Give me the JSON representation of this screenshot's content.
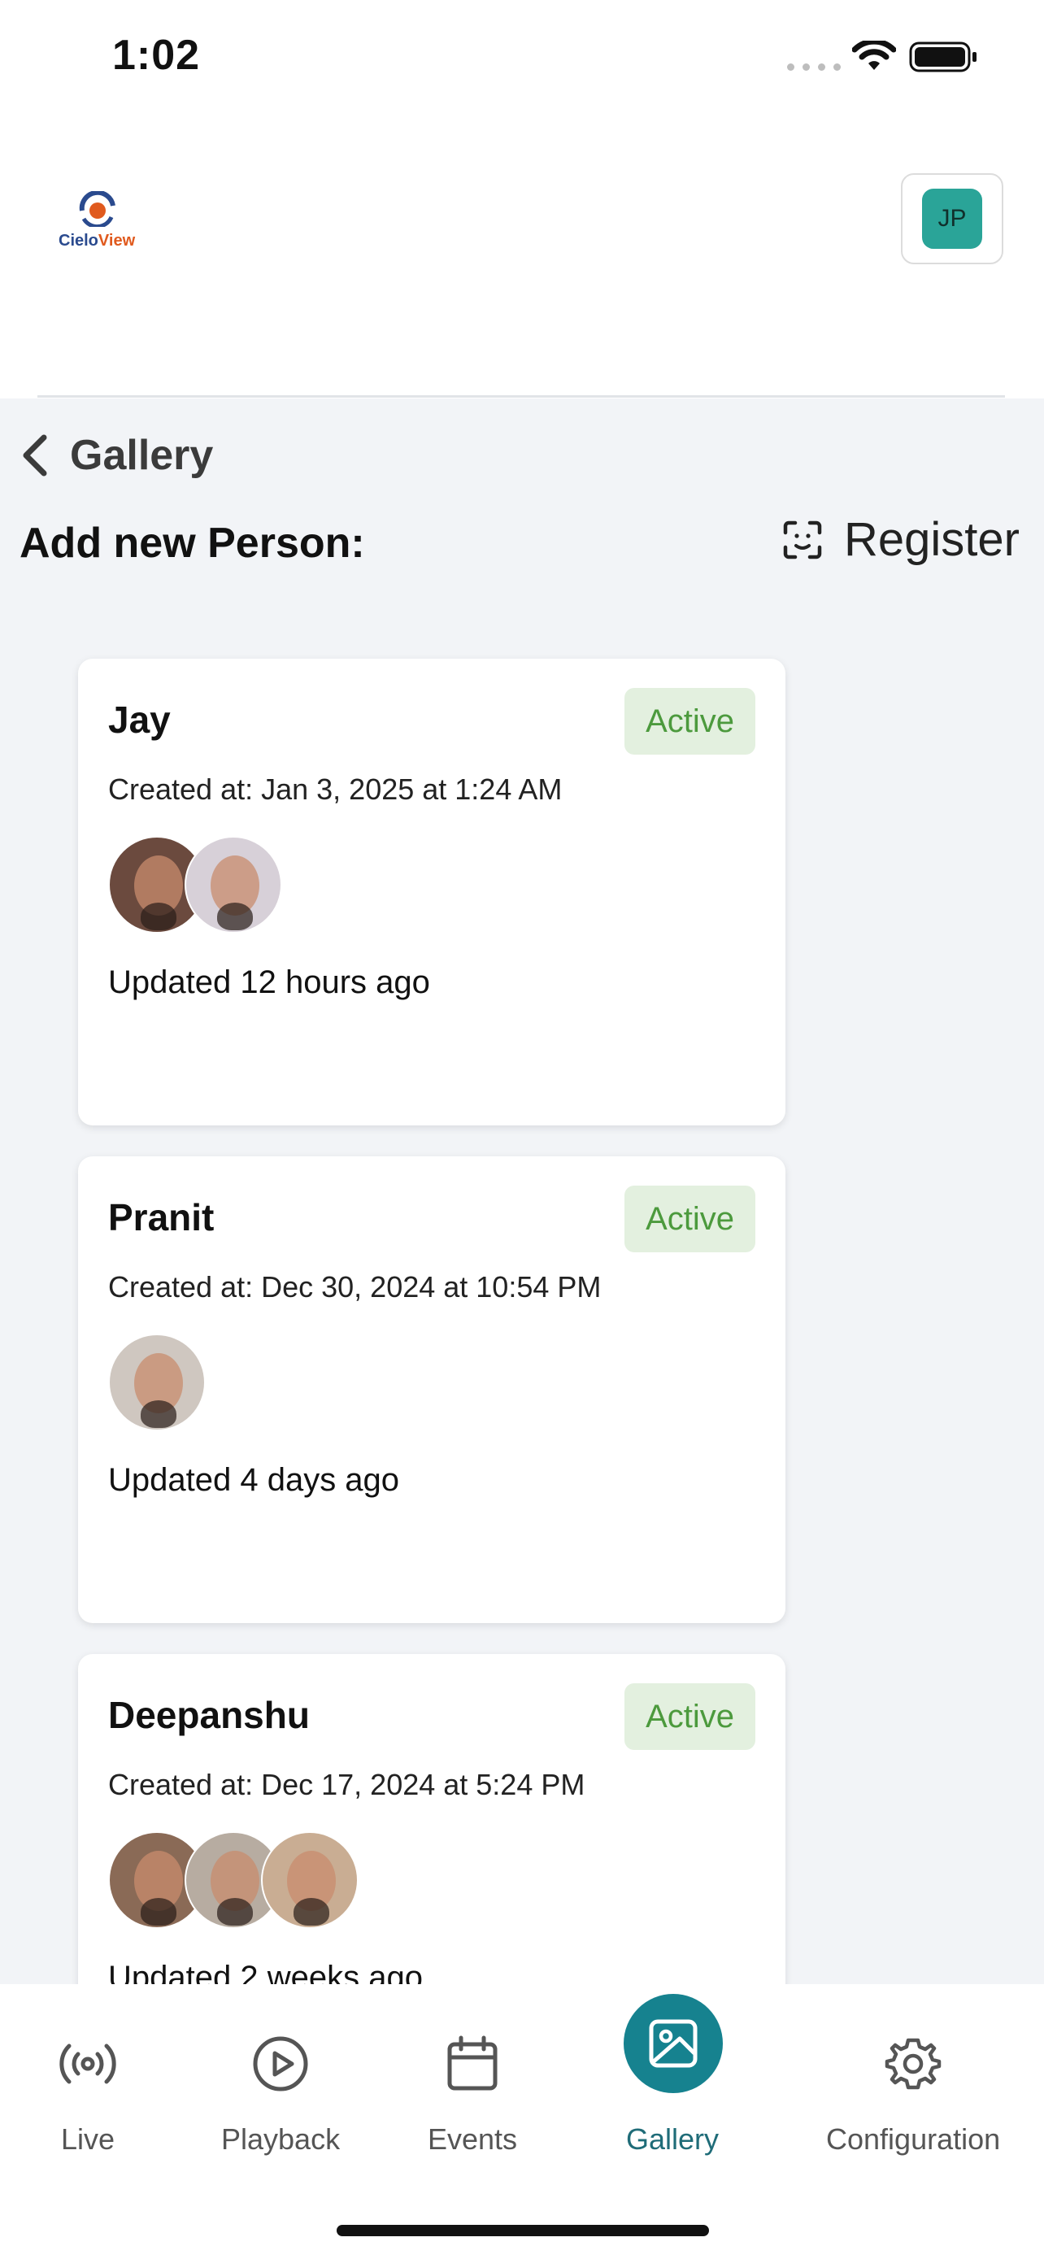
{
  "status_bar": {
    "time": "1:02"
  },
  "header": {
    "logo_text_a": "Cielo",
    "logo_text_b": "View",
    "user_initials": "JP"
  },
  "nav": {
    "back_title": "Gallery"
  },
  "add_person": {
    "label": "Add new Person:",
    "register_label": "Register"
  },
  "people": [
    {
      "name": "Jay",
      "status": "Active",
      "created": "Created at: Jan 3, 2025 at 1:24 AM",
      "updated": "Updated 12 hours ago",
      "photo_count": 2
    },
    {
      "name": "Pranit",
      "status": "Active",
      "created": "Created at: Dec 30, 2024 at 10:54 PM",
      "updated": "Updated 4 days ago",
      "photo_count": 1
    },
    {
      "name": "Deepanshu",
      "status": "Active",
      "created": "Created at: Dec 17, 2024 at 5:24 PM",
      "updated": "Updated 2 weeks ago",
      "photo_count": 3
    }
  ],
  "bottom_nav": {
    "items": [
      {
        "label": "Live",
        "icon": "broadcast-icon"
      },
      {
        "label": "Playback",
        "icon": "play-circle-icon"
      },
      {
        "label": "Events",
        "icon": "calendar-icon"
      },
      {
        "label": "Gallery",
        "icon": "image-icon"
      },
      {
        "label": "Configuration",
        "icon": "gear-icon"
      }
    ],
    "active": "Gallery"
  },
  "colors": {
    "accent": "#16828f",
    "badge_bg": "#e3f0df",
    "badge_text": "#4c9a3d",
    "avatar": "#2aa498"
  }
}
